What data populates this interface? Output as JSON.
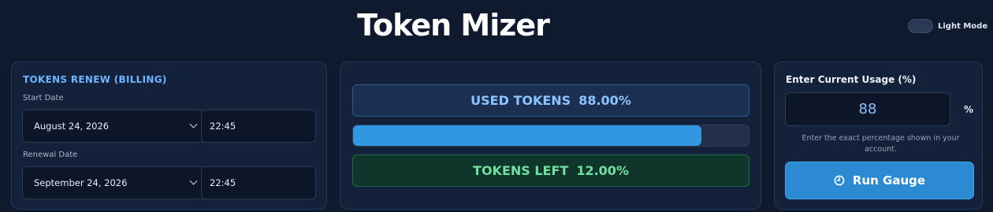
{
  "app": {
    "title": "Token Mizer",
    "theme_toggle_label": "Light Mode"
  },
  "billing": {
    "title": "TOKENS RENEW (BILLING)",
    "start_label": "Start Date",
    "start_date": "August 24, 2026",
    "start_time": "22:45",
    "renewal_label": "Renewal Date",
    "renewal_date": "September 24, 2026",
    "renewal_time": "22:45"
  },
  "gauge": {
    "used_label": "USED TOKENS",
    "used_value": "88.00%",
    "progress_percent": 88,
    "left_label": "TOKENS LEFT",
    "left_value": "12.00%"
  },
  "usage": {
    "title": "Enter Current Usage (%)",
    "value": "88",
    "unit": "%",
    "hint": "Enter the exact percentage shown in your account.",
    "run_label": "Run Gauge"
  },
  "colors": {
    "background": "#0f1a2e",
    "accent_blue": "#3097e0",
    "used_text": "#8cc4ff",
    "left_text": "#6fe0a0",
    "billing_title": "#6fb4ff"
  }
}
